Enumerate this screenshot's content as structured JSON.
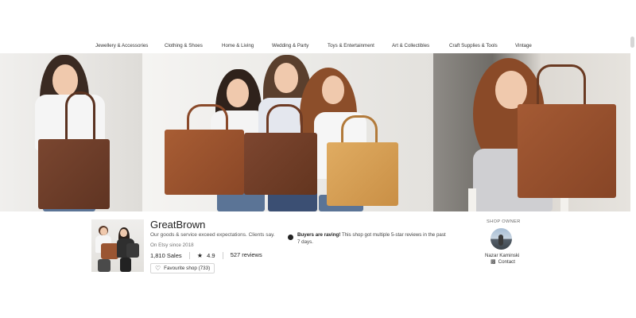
{
  "nav": {
    "categories": [
      "Jewellery & Accessories",
      "Clothing & Shoes",
      "Home & Living",
      "Wedding & Party",
      "Toys & Entertainment",
      "Art & Collectibles",
      "Craft Supplies & Tools",
      "Vintage"
    ]
  },
  "shop": {
    "name": "GreatBrown",
    "tagline": "Our goods & service exceed expectations. Clients say.",
    "since": "On Etsy since 2018",
    "sales": "1,810 Sales",
    "rating": "4.9",
    "rating_icon": "star-icon",
    "reviews": "527 reviews",
    "favourite_button": "Favourite shop (733)",
    "favourite_icon": "heart-icon"
  },
  "notice": {
    "headline": "Buyers are raving!",
    "text": "This shop got multiple 5-star reviews in the past 7 days.",
    "icon": "speech-bubble-icon"
  },
  "owner": {
    "label": "SHOP OWNER",
    "name": "Nazar Kaminski",
    "contact": "Contact",
    "contact_icon": "message-icon"
  },
  "colors": {
    "leather_dark": "#8a4a2a",
    "leather_mid": "#a0552f",
    "leather_light": "#d9a35c",
    "text": "#222222"
  }
}
